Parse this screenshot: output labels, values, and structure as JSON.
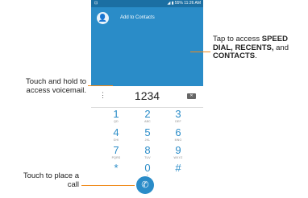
{
  "status_bar": {
    "left": "⊡",
    "battery": "55%",
    "time": "11:26 AM"
  },
  "app_bar": {
    "add_contacts_label": "Add to Contacts",
    "avatar_icon": "person-add-icon"
  },
  "dialpad": {
    "number": "1234",
    "keys": [
      {
        "digit": "1",
        "letters": "QD"
      },
      {
        "digit": "2",
        "letters": "ABC"
      },
      {
        "digit": "3",
        "letters": "DEF"
      },
      {
        "digit": "4",
        "letters": "GHI"
      },
      {
        "digit": "5",
        "letters": "JKL"
      },
      {
        "digit": "6",
        "letters": "MNO"
      },
      {
        "digit": "7",
        "letters": "PQRS"
      },
      {
        "digit": "8",
        "letters": "TUV"
      },
      {
        "digit": "9",
        "letters": "WXYZ"
      },
      {
        "digit": "*",
        "letters": ""
      },
      {
        "digit": "0",
        "letters": "+"
      },
      {
        "digit": "#",
        "letters": ""
      }
    ]
  },
  "callouts": {
    "speed_dial_prefix": "Tap to access ",
    "speed_dial_bold": "SPEED DIAL, RECENTS,",
    "speed_dial_mid": " and ",
    "speed_dial_bold2": "CONTACTS",
    "speed_dial_suffix": ".",
    "voicemail": "Touch and hold to access voicemail.",
    "call": "Touch to place a call"
  },
  "colors": {
    "primary": "#2a8cc8",
    "status_bar": "#1b6fa3",
    "callout_line": "#f08a1a"
  }
}
